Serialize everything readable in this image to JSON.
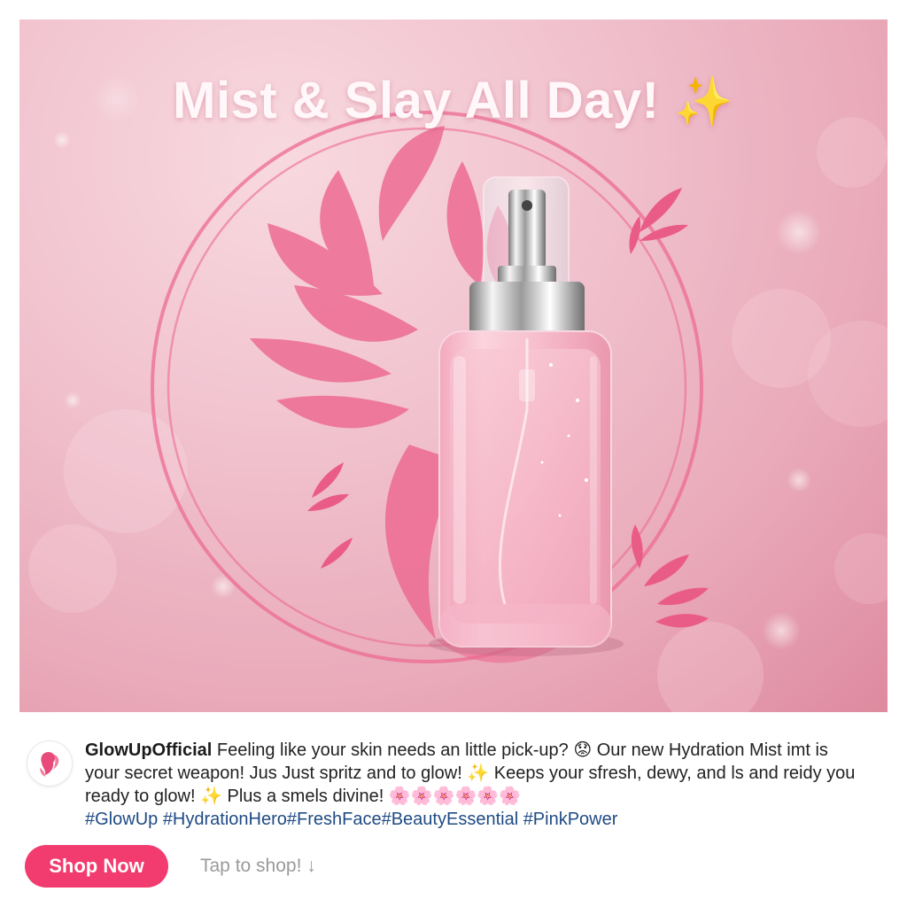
{
  "hero": {
    "headline": "Mist & Slay All Day!",
    "headline_emoji": "✨"
  },
  "post": {
    "username": "GlowUpOfficial",
    "caption_lines": [
      "Feeling like your skin needs an little pick-up? 😟 Our new Hydration Mist",
      "imt is your secret weapon! Jus Just spritz and to glow! ✨ Keeps your sfresh, dewy, and ls",
      "and reidy you ready to glow! ✨ Plus a smels divine! 🌸🌸🌸🌸🌸🌸"
    ],
    "hashtags": "#GlowUp #HydrationHero#FreshFace#BeautyEssential #PinkPower",
    "shop_button": "Shop Now",
    "tap_hint": "Tap to shop! ↓"
  },
  "colors": {
    "accent": "#f23b6e",
    "hashtag": "#1f4b84",
    "hero_pink": "#e9a9b9",
    "leaf_pink": "#ec6b93"
  },
  "icons": {
    "avatar": "woman-profile-logo-icon",
    "bottle": "spray-bottle-icon"
  }
}
